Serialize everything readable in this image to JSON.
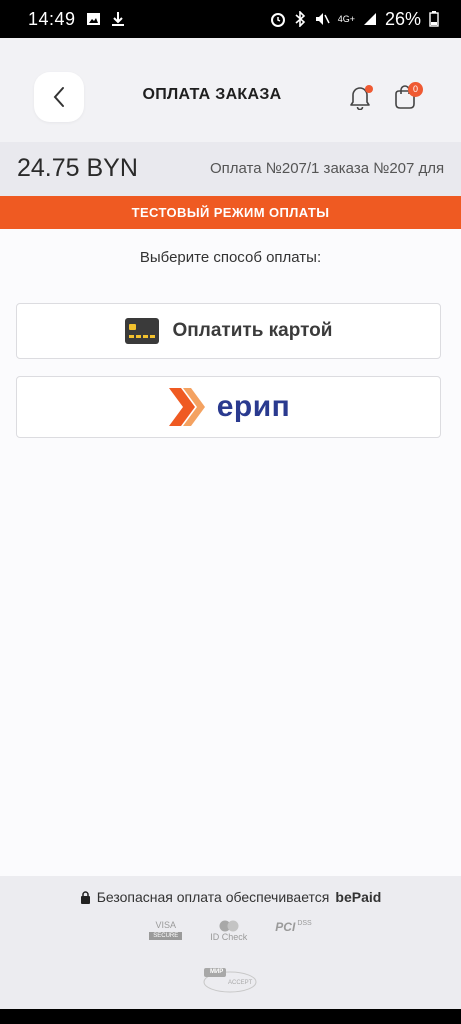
{
  "status_bar": {
    "time": "14:49",
    "network": "4G+",
    "battery": "26%",
    "icons": [
      "image-icon",
      "download-icon",
      "alarm-icon",
      "bluetooth-icon",
      "mute-icon",
      "signal-icon",
      "battery-icon"
    ]
  },
  "header": {
    "title": "ОПЛАТА ЗАКАЗА",
    "cart_count": "0"
  },
  "payment": {
    "amount": "24.75 BYN",
    "description": "Оплата №207/1 заказа №207 для"
  },
  "banner": {
    "text": "ТЕСТОВЫЙ РЕЖИМ ОПЛАТЫ"
  },
  "methods": {
    "prompt": "Выберите способ оплаты:",
    "card_label": "Оплатить картой",
    "erip_label": "ерип"
  },
  "footer": {
    "secure_text": "Безопасная оплата обеспечивается",
    "provider": "bePaid",
    "logos": {
      "visa": "VISA",
      "visa_sub": "SECURE",
      "mastercard": "ID Check",
      "pci": "PCI",
      "pci_sub": "DSS",
      "mir": "МИР",
      "mir_sub": "ACCEPT"
    }
  },
  "colors": {
    "accent": "#ef5a22",
    "erip_blue": "#2a3a8f",
    "header_bg": "#f2f2f5"
  }
}
